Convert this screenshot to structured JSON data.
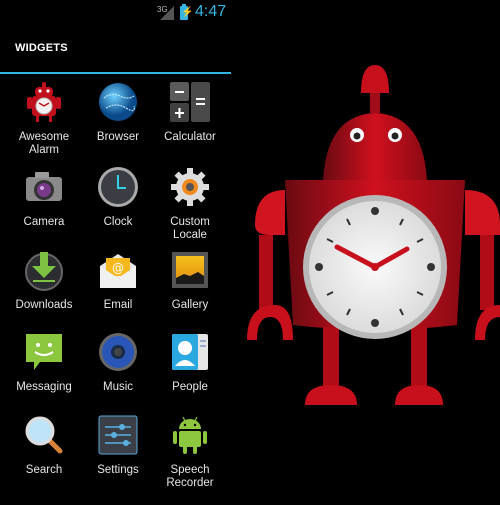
{
  "status_bar": {
    "network_type": "3G",
    "time": "4:47",
    "signal_icon": "signal-icon",
    "battery_icon": "battery-charging-icon"
  },
  "drawer": {
    "tab_title": "WIDGETS",
    "accent_color": "#33b5e5",
    "apps": [
      {
        "label": "Awesome Alarm",
        "icon": "robot-alarm-icon"
      },
      {
        "label": "Browser",
        "icon": "globe-icon"
      },
      {
        "label": "Calculator",
        "icon": "calculator-icon"
      },
      {
        "label": "Camera",
        "icon": "camera-icon"
      },
      {
        "label": "Clock",
        "icon": "clock-icon"
      },
      {
        "label": "Custom Locale",
        "icon": "gear-icon"
      },
      {
        "label": "Downloads",
        "icon": "download-icon"
      },
      {
        "label": "Email",
        "icon": "envelope-icon"
      },
      {
        "label": "Gallery",
        "icon": "gallery-icon"
      },
      {
        "label": "Messaging",
        "icon": "message-icon"
      },
      {
        "label": "Music",
        "icon": "speaker-icon"
      },
      {
        "label": "People",
        "icon": "contact-card-icon"
      },
      {
        "label": "Search",
        "icon": "magnifier-icon"
      },
      {
        "label": "Settings",
        "icon": "sliders-icon"
      },
      {
        "label": "Speech Recorder",
        "icon": "android-icon"
      }
    ]
  },
  "wallpaper": {
    "subject": "red robot alarm clock",
    "clock_time": "10:10",
    "primary_color": "#d0101e"
  }
}
